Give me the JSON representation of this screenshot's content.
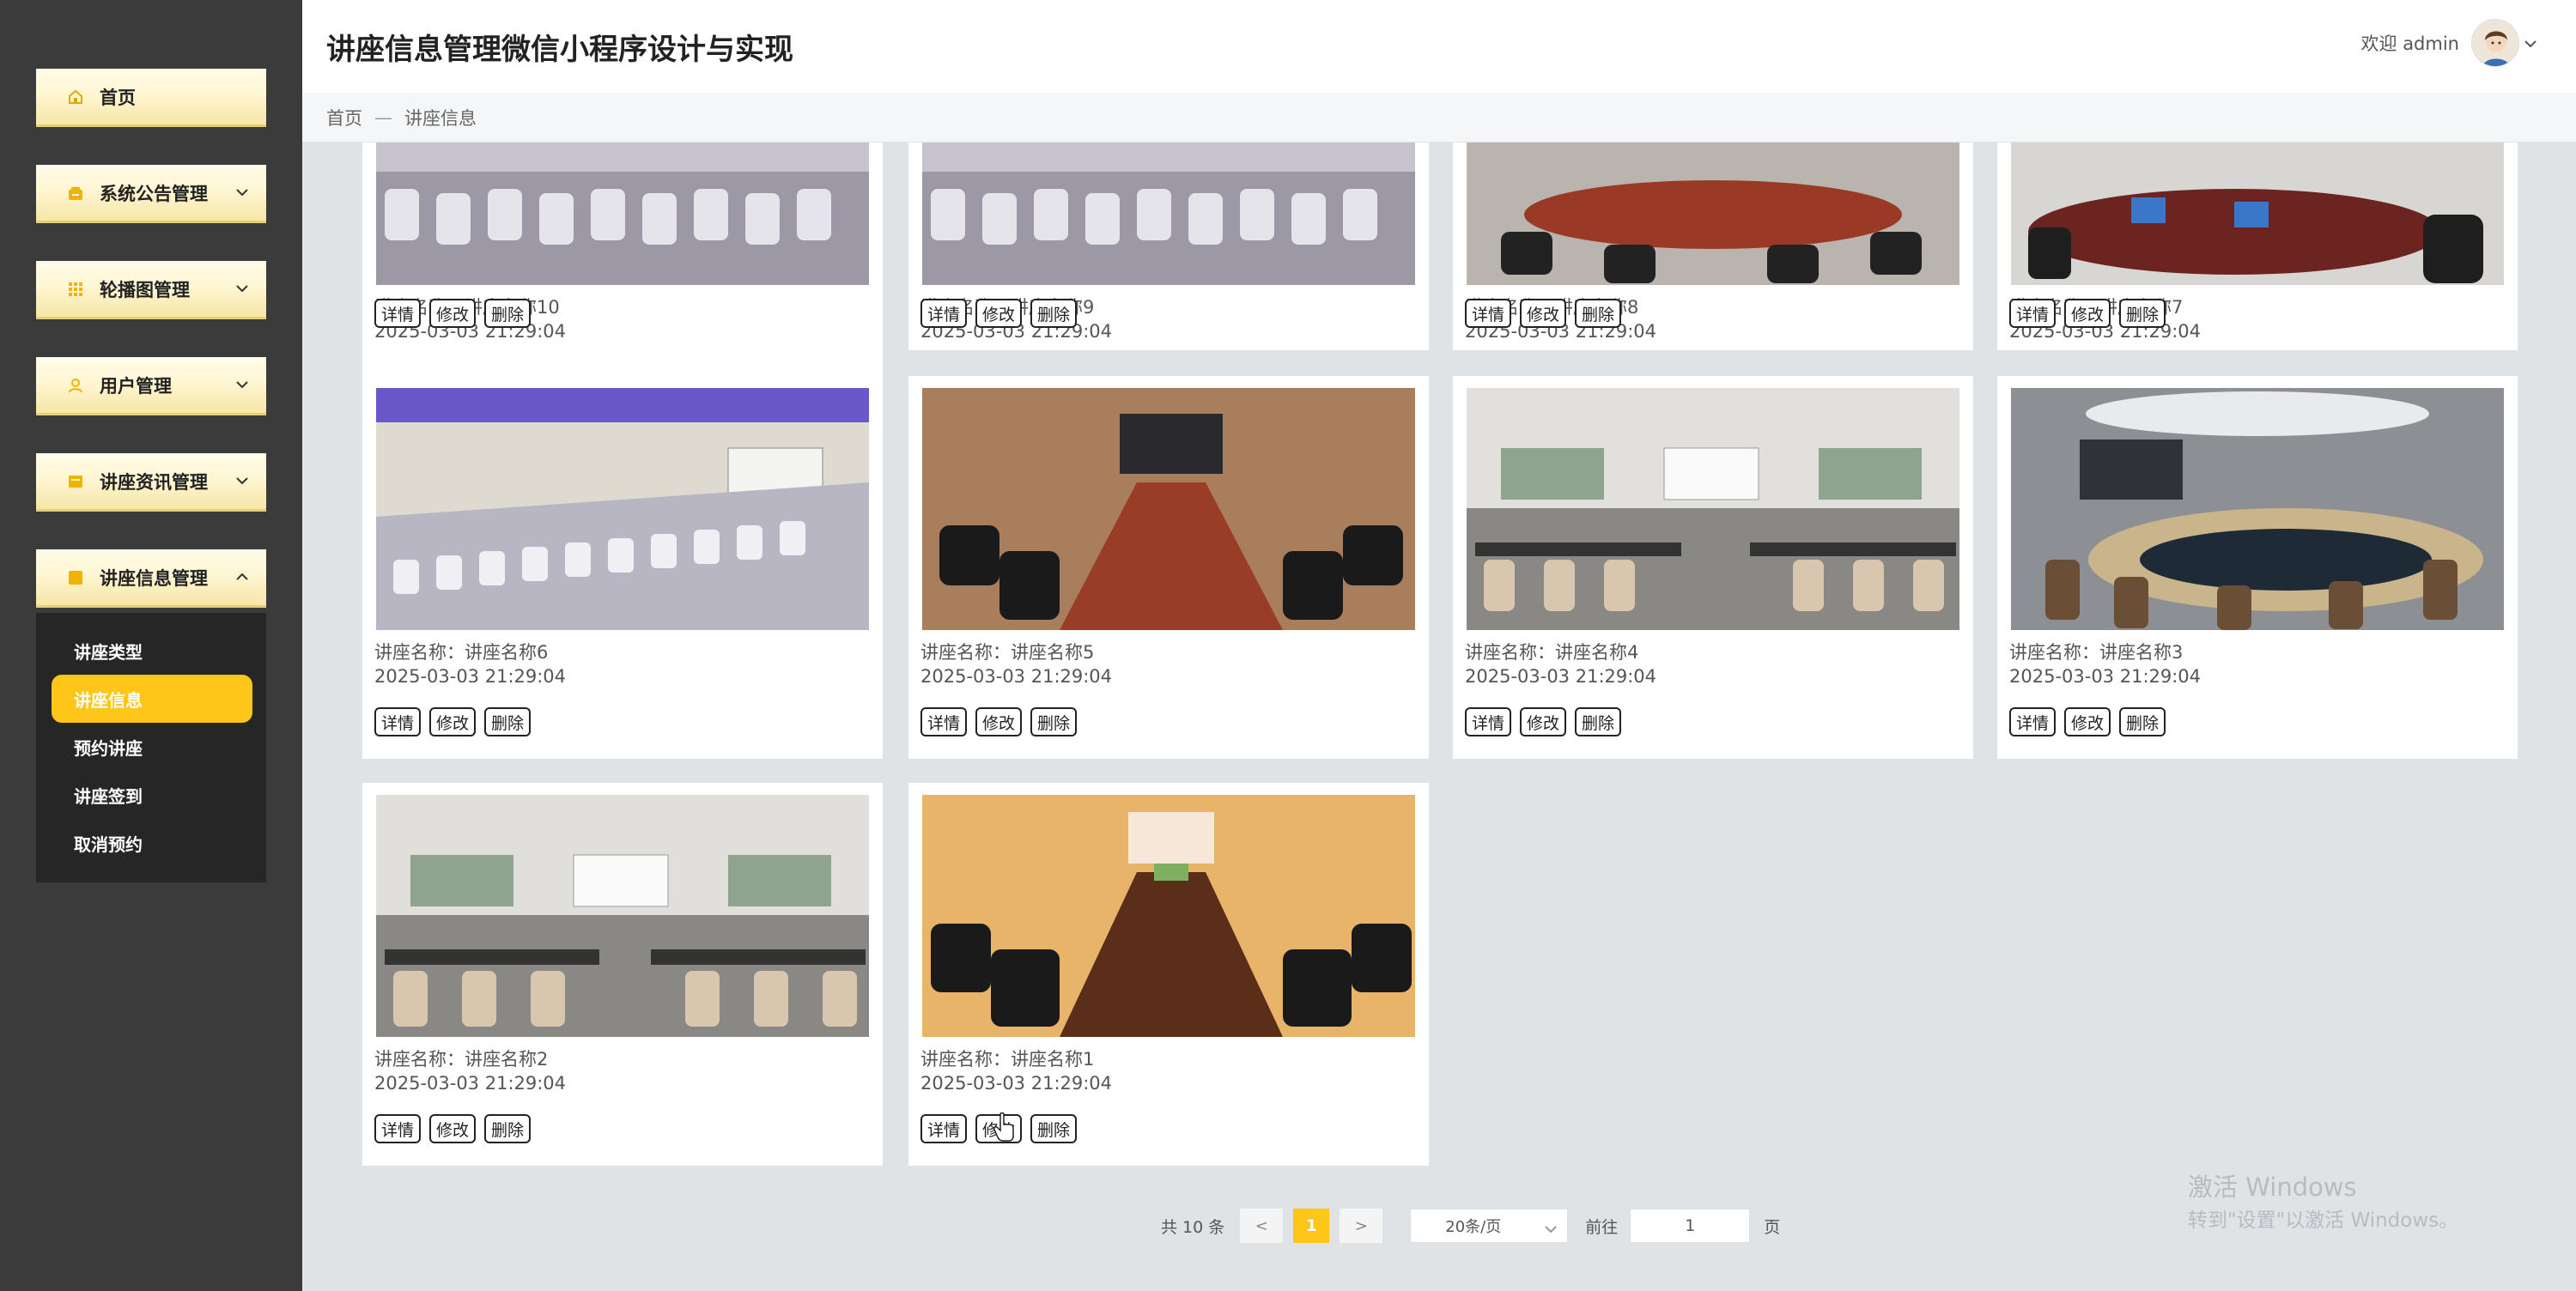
{
  "app": {
    "title": "讲座信息管理微信小程序设计与实现"
  },
  "user": {
    "welcome": "欢迎 admin"
  },
  "sidebar": {
    "items": [
      {
        "label": "首页",
        "icon": "home-icon"
      },
      {
        "label": "系统公告管理",
        "icon": "notice-icon"
      },
      {
        "label": "轮播图管理",
        "icon": "grid-icon"
      },
      {
        "label": "用户管理",
        "icon": "user-icon"
      },
      {
        "label": "讲座资讯管理",
        "icon": "news-icon"
      },
      {
        "label": "讲座信息管理",
        "icon": "lecture-icon"
      }
    ],
    "submenu": [
      {
        "label": "讲座类型"
      },
      {
        "label": "讲座信息",
        "active": true
      },
      {
        "label": "预约讲座"
      },
      {
        "label": "讲座签到"
      },
      {
        "label": "取消预约"
      }
    ],
    "accent": "#fdc619"
  },
  "breadcrumb": {
    "home": "首页",
    "sep": "—",
    "current": "讲座信息"
  },
  "cards": [
    {
      "name": "讲座名称：讲座名称10",
      "time": "2025-03-03 21:29:04"
    },
    {
      "name": "讲座名称：讲座名称9",
      "time": "2025-03-03 21:29:04"
    },
    {
      "name": "讲座名称：讲座名称8",
      "time": "2025-03-03 21:29:04"
    },
    {
      "name": "讲座名称：讲座名称7",
      "time": "2025-03-03 21:29:04"
    },
    {
      "name": "讲座名称：讲座名称6",
      "time": "2025-03-03 21:29:04"
    },
    {
      "name": "讲座名称：讲座名称5",
      "time": "2025-03-03 21:29:04"
    },
    {
      "name": "讲座名称：讲座名称4",
      "time": "2025-03-03 21:29:04"
    },
    {
      "name": "讲座名称：讲座名称3",
      "time": "2025-03-03 21:29:04"
    },
    {
      "name": "讲座名称：讲座名称2",
      "time": "2025-03-03 21:29:04"
    },
    {
      "name": "讲座名称：讲座名称1",
      "time": "2025-03-03 21:29:04"
    }
  ],
  "buttons": {
    "detail": "详情",
    "edit": "修改",
    "delete": "删除"
  },
  "pagination": {
    "total": "共 10 条",
    "prev": "<",
    "next": ">",
    "current": "1",
    "page_size": "20条/页",
    "goto_label": "前往",
    "goto_value": "1",
    "page_suffix": "页"
  },
  "watermark": {
    "line1": "激活 Windows",
    "line2": "转到\"设置\"以激活 Windows。"
  }
}
